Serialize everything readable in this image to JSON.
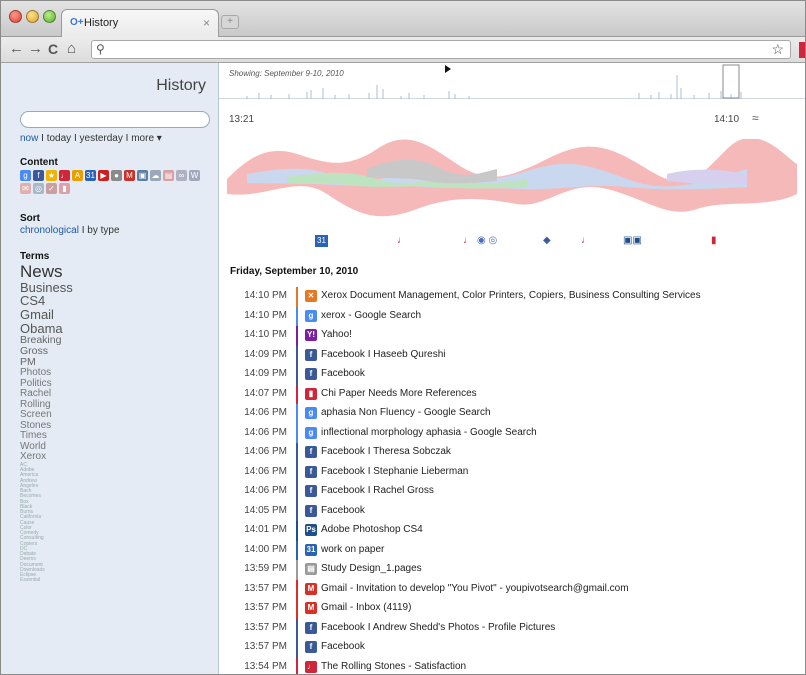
{
  "browser": {
    "tab_title": "History",
    "tab_favicon": "O+",
    "tab_close": "×",
    "new_tab": "+",
    "back": "←",
    "forward": "→",
    "reload": "C",
    "home": "⌂",
    "search_glyph": "⚲",
    "star": "☆"
  },
  "sidebar": {
    "title": "History",
    "search_value": "",
    "range": {
      "now": "now",
      "today": "today",
      "yesterday": "yesterday",
      "more": "more ▾",
      "sep": " I "
    },
    "content_heading": "Content",
    "sort_heading": "Sort",
    "sort_chronological": "chronological",
    "sort_by_type": "by type",
    "sort_sep": " I ",
    "terms_heading": "Terms",
    "content_icons": [
      {
        "name": "google-icon",
        "color": "#4a8af4",
        "glyph": "g"
      },
      {
        "name": "facebook-icon",
        "color": "#3b5998",
        "glyph": "f"
      },
      {
        "name": "star-icon",
        "color": "#f0b400",
        "glyph": "★"
      },
      {
        "name": "music-icon",
        "color": "#d0263a",
        "glyph": "♩"
      },
      {
        "name": "acrobat-icon",
        "color": "#e8a000",
        "glyph": "A"
      },
      {
        "name": "calendar-icon",
        "color": "#2a62b8",
        "glyph": "31"
      },
      {
        "name": "youtube-icon",
        "color": "#cc2020",
        "glyph": "▶"
      },
      {
        "name": "disc-icon",
        "color": "#8a8a8a",
        "glyph": "●"
      },
      {
        "name": "gmail-icon",
        "color": "#c8322a",
        "glyph": "M"
      },
      {
        "name": "photo-icon",
        "color": "#5a7fa0",
        "glyph": "▣"
      },
      {
        "name": "cloud-icon",
        "color": "#9aa8b8",
        "glyph": "☁"
      },
      {
        "name": "doc-icon",
        "color": "#d8a0a0",
        "glyph": "▤"
      },
      {
        "name": "chain-icon",
        "color": "#b0b0c0",
        "glyph": "∞"
      },
      {
        "name": "word-icon",
        "color": "#a0a8c0",
        "glyph": "W"
      },
      {
        "name": "mail-icon",
        "color": "#e0b0b0",
        "glyph": "✉"
      },
      {
        "name": "globe-icon",
        "color": "#a8b8c8",
        "glyph": "◎"
      },
      {
        "name": "pin-icon",
        "color": "#c8a0a0",
        "glyph": "✓"
      },
      {
        "name": "bookmark-icon",
        "color": "#e0a0a8",
        "glyph": "▮"
      }
    ],
    "terms": [
      {
        "text": "News",
        "size": 17,
        "color": "#333"
      },
      {
        "text": "Business",
        "size": 13,
        "color": "#555"
      },
      {
        "text": "CS4",
        "size": 13,
        "color": "#555"
      },
      {
        "text": "Gmail",
        "size": 13,
        "color": "#555"
      },
      {
        "text": "Obama",
        "size": 13,
        "color": "#555"
      },
      {
        "text": "Breaking",
        "size": 10.5,
        "color": "#666"
      },
      {
        "text": "Gross",
        "size": 10.5,
        "color": "#666"
      },
      {
        "text": "PM",
        "size": 10.5,
        "color": "#666"
      },
      {
        "text": "Photos",
        "size": 10,
        "color": "#777"
      },
      {
        "text": "Politics",
        "size": 10,
        "color": "#777"
      },
      {
        "text": "Rachel",
        "size": 10,
        "color": "#777"
      },
      {
        "text": "Rolling",
        "size": 10,
        "color": "#777"
      },
      {
        "text": "Screen",
        "size": 10,
        "color": "#777"
      },
      {
        "text": "Stones",
        "size": 10,
        "color": "#777"
      },
      {
        "text": "Times",
        "size": 10,
        "color": "#777"
      },
      {
        "text": "World",
        "size": 10,
        "color": "#777"
      },
      {
        "text": "Xerox",
        "size": 10,
        "color": "#777"
      },
      {
        "text": "AC",
        "size": 5,
        "color": "#9aa"
      },
      {
        "text": "Adobe",
        "size": 5,
        "color": "#9aa"
      },
      {
        "text": "America",
        "size": 5,
        "color": "#9aa"
      },
      {
        "text": "Andrew",
        "size": 5,
        "color": "#9aa"
      },
      {
        "text": "Angeles",
        "size": 5,
        "color": "#9aa"
      },
      {
        "text": "Bach",
        "size": 5,
        "color": "#9aa"
      },
      {
        "text": "Becomes",
        "size": 5,
        "color": "#9aa"
      },
      {
        "text": "Box",
        "size": 5,
        "color": "#9aa"
      },
      {
        "text": "Black",
        "size": 5,
        "color": "#9aa"
      },
      {
        "text": "Burns",
        "size": 5,
        "color": "#9aa"
      },
      {
        "text": "California",
        "size": 5,
        "color": "#9aa"
      },
      {
        "text": "Cause",
        "size": 5,
        "color": "#9aa"
      },
      {
        "text": "Color",
        "size": 5,
        "color": "#9aa"
      },
      {
        "text": "Comedy",
        "size": 5,
        "color": "#9aa"
      },
      {
        "text": "Consulting",
        "size": 5,
        "color": "#9aa"
      },
      {
        "text": "Copiers",
        "size": 5,
        "color": "#9aa"
      },
      {
        "text": "DC",
        "size": 5,
        "color": "#9aa"
      },
      {
        "text": "Debate",
        "size": 5,
        "color": "#9aa"
      },
      {
        "text": "Deems",
        "size": 5,
        "color": "#9aa"
      },
      {
        "text": "Document",
        "size": 5,
        "color": "#9aa"
      },
      {
        "text": "Downloads",
        "size": 5,
        "color": "#9aa"
      },
      {
        "text": "Eclipse",
        "size": 5,
        "color": "#9aa"
      },
      {
        "text": "Essential",
        "size": 5,
        "color": "#9aa"
      }
    ]
  },
  "main": {
    "showing": "Showing: September 9-10, 2010",
    "time_left": "13:21",
    "time_right": "14:10",
    "collapse_glyph": "≈",
    "date_heading": "Friday, September 10, 2010",
    "colors": {
      "facebook": "#3b5998",
      "google": "#4a8af4",
      "gmail": "#d93025",
      "music": "#d0263a",
      "yahoo": "#7b1fa2",
      "xerox": "#e87722",
      "calendar": "#2a62b8",
      "photoshop": "#1f4f8a"
    },
    "event_icons": [
      {
        "name": "calendar-icon",
        "glyph": "31",
        "color": "#2a62b8",
        "bg": true
      },
      {
        "name": "music-icon",
        "glyph": "♩",
        "color": "#d0263a"
      },
      {
        "name": "music-icon",
        "glyph": "♩",
        "color": "#d0263a"
      },
      {
        "name": "cloud-icon",
        "glyph": "◉ ◎",
        "color": "#4a6fb8"
      },
      {
        "name": "globe-icon",
        "glyph": "◆",
        "color": "#3a5aa8"
      },
      {
        "name": "music-icon",
        "glyph": "♩",
        "color": "#d0263a"
      },
      {
        "name": "photoshop-icon",
        "glyph": "▣▣",
        "color": "#1f4f8a"
      },
      {
        "name": "bookmark-icon",
        "glyph": "▮",
        "color": "#d0263a"
      }
    ],
    "rows": [
      {
        "time": "14:10 PM",
        "title": "Xerox Document Management, Color Printers, Copiers, Business Consulting Services",
        "icon": "xerox-icon",
        "glyph": "✕",
        "color": "#e87722",
        "bar": "#e87722"
      },
      {
        "time": "14:10 PM",
        "title": "xerox - Google Search",
        "icon": "google-icon",
        "glyph": "g",
        "color": "#4a8af4",
        "bar": "#4a8af4"
      },
      {
        "time": "14:10 PM",
        "title": "Yahoo!",
        "icon": "yahoo-icon",
        "glyph": "Y!",
        "color": "#7b1fa2",
        "bar": "#7b1fa2"
      },
      {
        "time": "14:09 PM",
        "title": "Facebook I Haseeb Qureshi",
        "icon": "facebook-icon",
        "glyph": "f",
        "color": "#3b5998",
        "bar": "#3b5998"
      },
      {
        "time": "14:09 PM",
        "title": "Facebook",
        "icon": "facebook-icon",
        "glyph": "f",
        "color": "#3b5998",
        "bar": "#3b5998"
      },
      {
        "time": "14:07 PM",
        "title": "Chi Paper Needs More References",
        "icon": "bookmark-icon",
        "glyph": "▮",
        "color": "#d0263a",
        "bar": "#d0263a"
      },
      {
        "time": "14:06 PM",
        "title": "aphasia Non Fluency - Google Search",
        "icon": "google-icon",
        "glyph": "g",
        "color": "#4a8af4",
        "bar": "#4a8af4"
      },
      {
        "time": "14:06 PM",
        "title": "inflectional morphology aphasia - Google Search",
        "icon": "google-icon",
        "glyph": "g",
        "color": "#4a8af4",
        "bar": "#4a8af4"
      },
      {
        "time": "14:06 PM",
        "title": "Facebook I Theresa Sobczak",
        "icon": "facebook-icon",
        "glyph": "f",
        "color": "#3b5998",
        "bar": "#3b5998"
      },
      {
        "time": "14:06 PM",
        "title": "Facebook I Stephanie Lieberman",
        "icon": "facebook-icon",
        "glyph": "f",
        "color": "#3b5998",
        "bar": "#3b5998"
      },
      {
        "time": "14:06 PM",
        "title": "Facebook I Rachel Gross",
        "icon": "facebook-icon",
        "glyph": "f",
        "color": "#3b5998",
        "bar": "#3b5998"
      },
      {
        "time": "14:05 PM",
        "title": "Facebook",
        "icon": "facebook-icon",
        "glyph": "f",
        "color": "#3b5998",
        "bar": "#3b5998"
      },
      {
        "time": "14:01 PM",
        "title": "Adobe Photoshop CS4",
        "icon": "photoshop-icon",
        "glyph": "Ps",
        "color": "#1f4f8a",
        "bar": "#1f4f8a"
      },
      {
        "time": "14:00 PM",
        "title": "work on paper",
        "icon": "calendar-icon",
        "glyph": "31",
        "color": "#2a62b8",
        "bar": "#2a62b8"
      },
      {
        "time": "13:59 PM",
        "title": "Study Design_1.pages",
        "icon": "document-icon",
        "glyph": "▤",
        "color": "#9a9a9a",
        "bar": "#9a9a9a"
      },
      {
        "time": "13:57 PM",
        "title": "Gmail - Invitation to develop \"You Pivot\" - youpivotsearch@gmail.com",
        "icon": "gmail-icon",
        "glyph": "M",
        "color": "#d93025",
        "bar": "#d93025"
      },
      {
        "time": "13:57 PM",
        "title": "Gmail - Inbox (4119)",
        "icon": "gmail-icon",
        "glyph": "M",
        "color": "#d93025",
        "bar": "#d93025"
      },
      {
        "time": "13:57 PM",
        "title": "Facebook I Andrew Shedd's Photos - Profile Pictures",
        "icon": "facebook-icon",
        "glyph": "f",
        "color": "#3b5998",
        "bar": "#3b5998"
      },
      {
        "time": "13:57 PM",
        "title": "Facebook",
        "icon": "facebook-icon",
        "glyph": "f",
        "color": "#3b5998",
        "bar": "#3b5998"
      },
      {
        "time": "13:54 PM",
        "title": "The Rolling Stones - Satisfaction",
        "icon": "music-icon",
        "glyph": "♩",
        "color": "#d0263a",
        "bar": "#d0263a"
      }
    ]
  }
}
